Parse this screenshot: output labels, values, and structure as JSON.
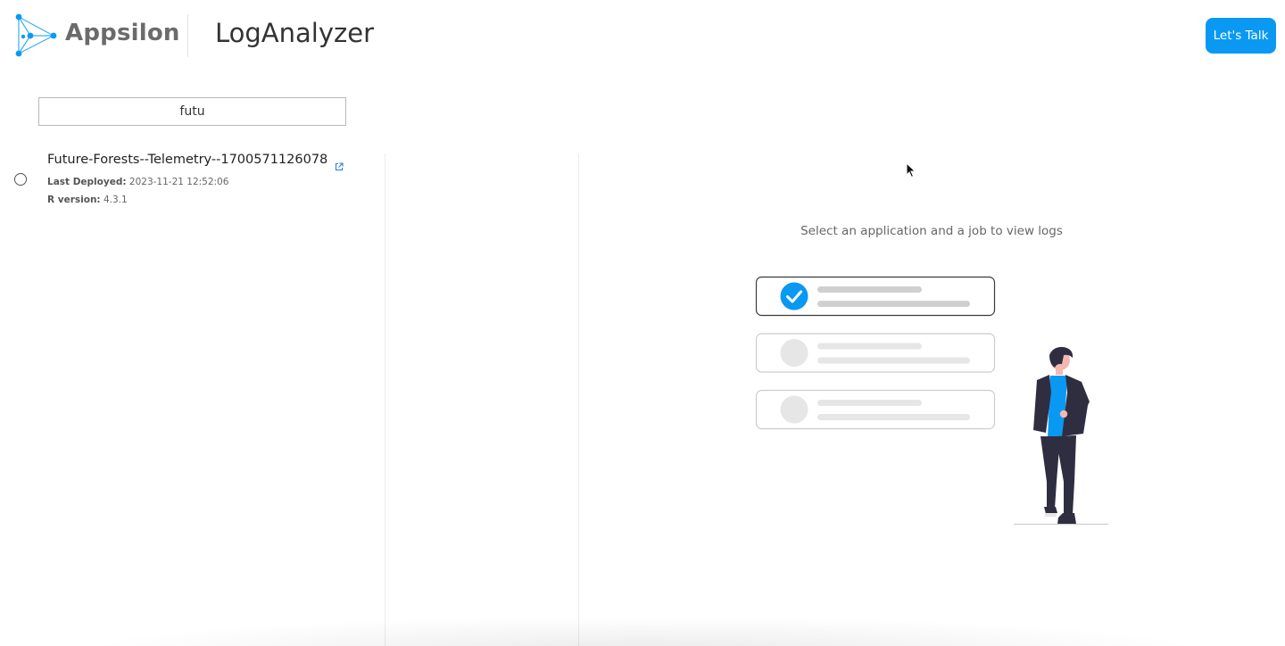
{
  "header": {
    "brand_name": "Appsilon",
    "app_title": "LogAnalyzer",
    "cta_label": "Let's Talk"
  },
  "search": {
    "value": "futu"
  },
  "apps": [
    {
      "name": "Future-Forests--Telemetry--1700571126078",
      "last_deployed_label": "Last Deployed:",
      "last_deployed_value": "2023-11-21 12:52:06",
      "r_version_label": "R version:",
      "r_version_value": "4.3.1",
      "link_icon": "external-link-icon"
    }
  ],
  "empty_state": {
    "message": "Select an application and a job to view logs"
  },
  "colors": {
    "accent": "#0a99f2",
    "divider": "#ececec",
    "text_muted": "#666666",
    "figure_dark": "#2f2e41"
  }
}
